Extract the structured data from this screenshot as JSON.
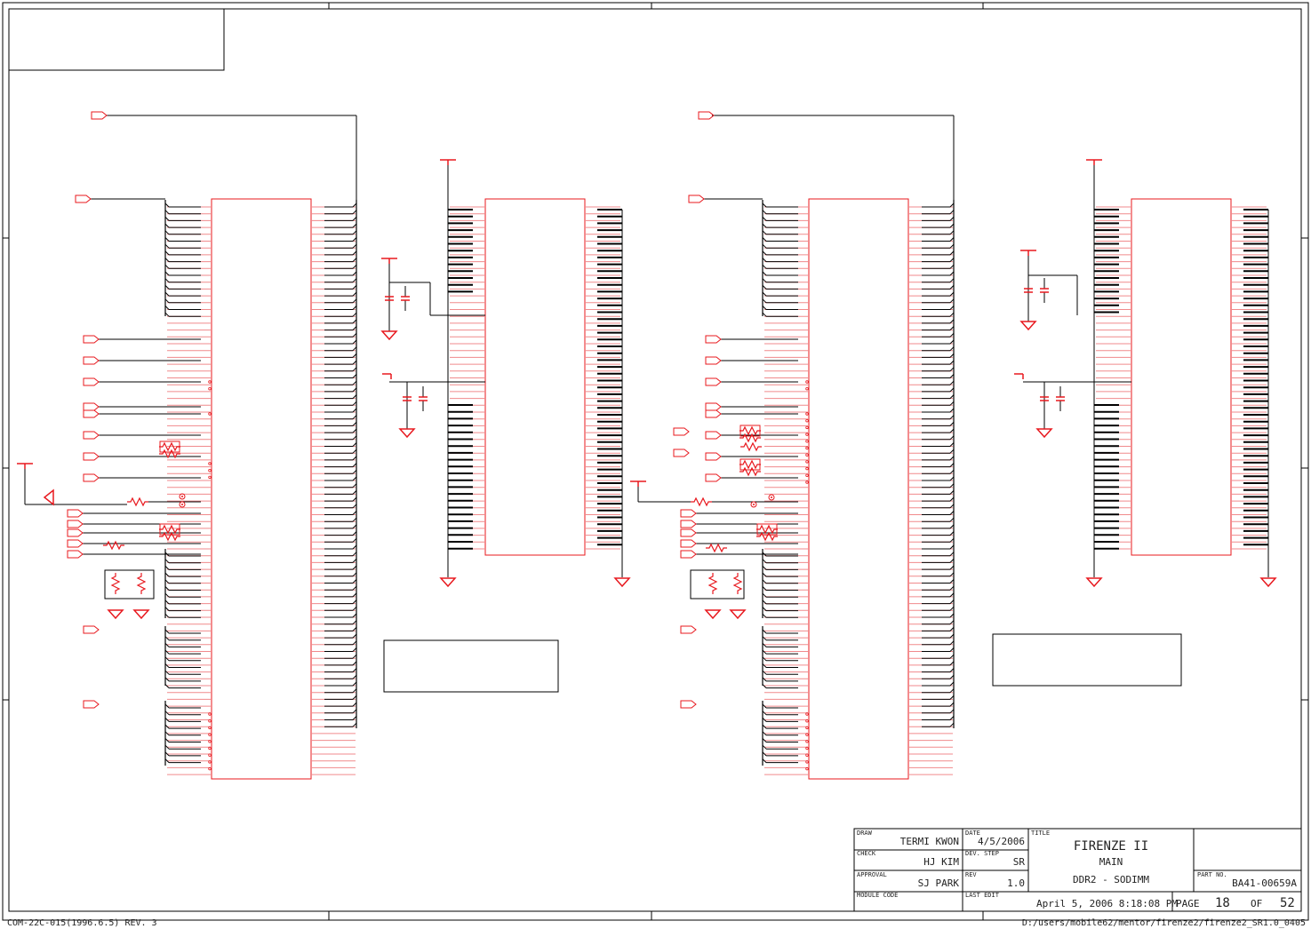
{
  "title_block": {
    "draw_label": "DRAW",
    "draw_value": "TERMI KWON",
    "check_label": "CHECK",
    "check_value": "HJ KIM",
    "approval_label": "APPROVAL",
    "approval_value": "SJ PARK",
    "module_code_label": "MODULE CODE",
    "date_label": "DATE",
    "date_value": "4/5/2006",
    "dev_step_label": "DEV. STEP",
    "dev_step_value": "SR",
    "rev_label": "REV",
    "rev_value": "1.0",
    "last_edit_label": "LAST EDIT",
    "last_edit_value": "April 5, 2006  8:18:08 PM",
    "title_label": "TITLE",
    "title_line1": "FIRENZE II",
    "title_line2": "MAIN",
    "title_line3": "DDR2 - SODIMM",
    "part_no_label": "PART NO.",
    "part_no_value": "BA41-00659A",
    "page_label": "PAGE",
    "page_value": "18",
    "of_label": "OF",
    "of_value": "52"
  },
  "footer": {
    "form_code": "COM-22C-015(1996.6.5) REV. 3",
    "file_path": "D:/users/mobile62/mentor/firenze2/firenze2_SR1.0_0405"
  },
  "colors": {
    "wire": "#000000",
    "component": "#e8181e",
    "pin": "#f08a8c",
    "frame": "#000000"
  }
}
